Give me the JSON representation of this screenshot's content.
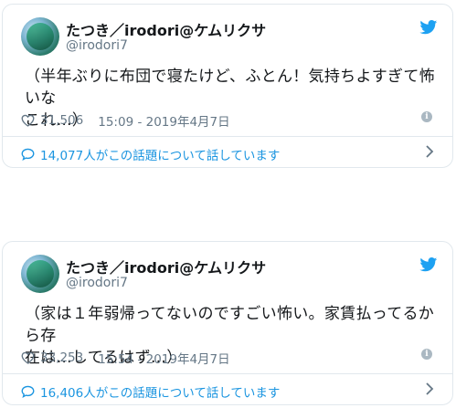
{
  "tweets": [
    {
      "name": "たつき／irodori@ケムリクサ",
      "handle": "@irodori7",
      "text_line1": "（半年ぶりに布団で寝たけど、ふとん！気持ちよすぎて怖いな",
      "text_line2": "これ…）",
      "likes": "31,506",
      "time": "15:09 - 2019年4月7日",
      "conversation": "14,077人がこの話題について話しています"
    },
    {
      "name": "たつき／irodori@ケムリクサ",
      "handle": "@irodori7",
      "text_line1": "（家は１年弱帰ってないのですごい怖い。家賃払ってるから存",
      "text_line2": "在は…してるはず…）",
      "likes": "33,253",
      "time": "15:54 - 2019年4月7日",
      "conversation": "16,406人がこの話題について話しています"
    }
  ],
  "icons": {
    "brand": "twitter-bird-icon",
    "like": "heart-icon",
    "info": "info-icon",
    "reply": "speech-bubble-icon",
    "more": "chevron-right-icon"
  },
  "colors": {
    "brand_blue": "#1da1f2",
    "link_blue": "#1b95e0",
    "muted": "#657786",
    "border": "#e1e8ed"
  }
}
